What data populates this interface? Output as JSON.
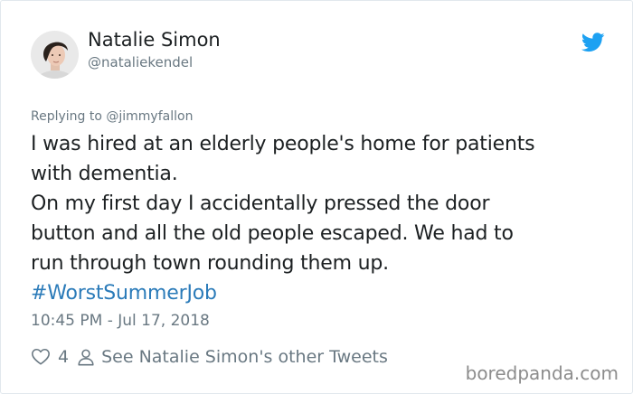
{
  "author": {
    "name": "Natalie Simon",
    "handle": "@nataliekendel"
  },
  "reply_context": "Replying to @jimmyfallon",
  "tweet": {
    "lines": [
      "I was hired at an elderly people's home for patients",
      "with dementia.",
      "On my first day I accidentally pressed the door",
      "button and all the old people escaped. We had to",
      "run through town rounding them up."
    ],
    "hashtag": "#WorstSummerJob"
  },
  "timestamp": "10:45 PM - Jul 17, 2018",
  "actions": {
    "likes": "4",
    "other_tweets_label": "See Natalie Simon's other Tweets"
  },
  "watermark": "boredpanda.com",
  "colors": {
    "text": "#1c2022",
    "secondary": "#697882",
    "link": "#2b7bb9",
    "twitter_blue": "#1da1f2",
    "border": "#e1e8ed"
  },
  "icons": {
    "brand": "twitter-bird-icon",
    "like": "heart-icon",
    "profile": "person-icon"
  }
}
